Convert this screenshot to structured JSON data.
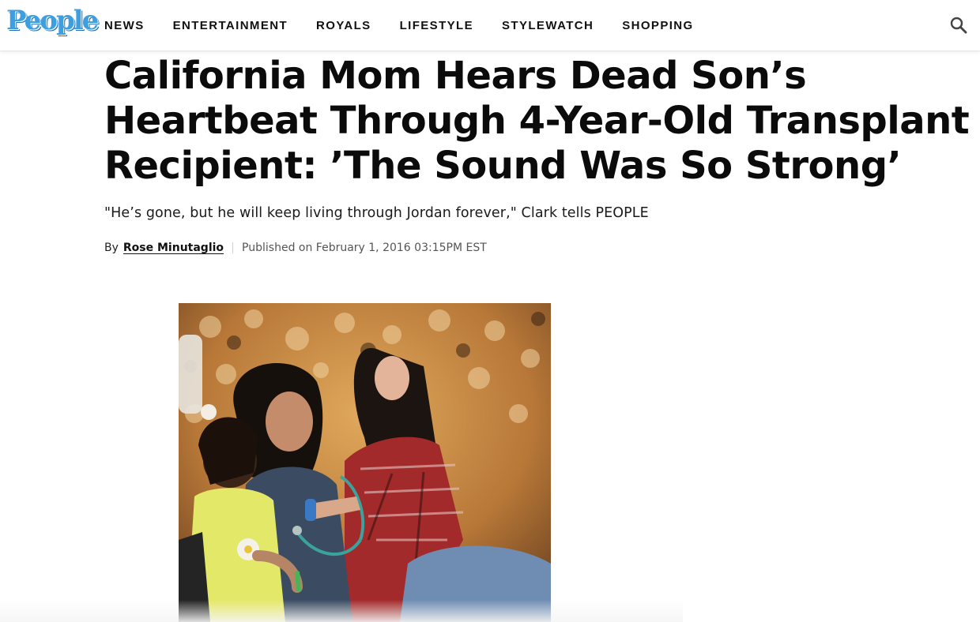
{
  "brand": {
    "logo_text": "People",
    "logo_color": "#3e9fe0"
  },
  "nav": {
    "items": [
      {
        "label": "NEWS"
      },
      {
        "label": "ENTERTAINMENT"
      },
      {
        "label": "ROYALS"
      },
      {
        "label": "LIFESTYLE"
      },
      {
        "label": "STYLEWATCH"
      },
      {
        "label": "SHOPPING"
      }
    ],
    "search_icon": "search-icon"
  },
  "article": {
    "headline": "California Mom Hears Dead Son’s Heartbeat Through 4-Year-Old Transplant Recipient: ’The Sound Was So Strong’",
    "dek": "\"He’s gone, but he will keep living through Jordan forever,\" Clark tells PEOPLE",
    "byline": {
      "prefix": "By",
      "author": "Rose Minutaglio",
      "published": "Published on February 1, 2016 03:15PM EST"
    }
  },
  "colors": {
    "text": "#111111",
    "divider": "#cfcfcf"
  }
}
